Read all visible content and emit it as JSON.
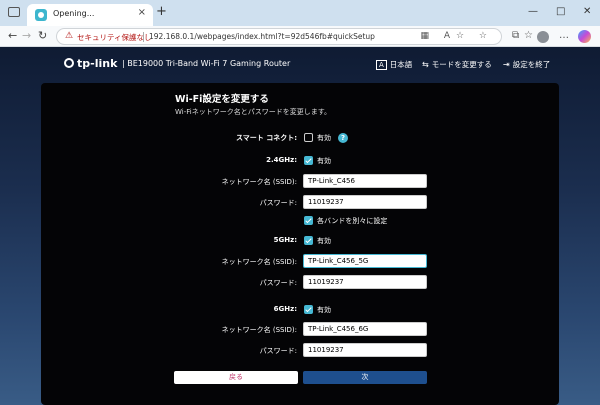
{
  "browser": {
    "tab_title": "Opening...",
    "tab_close": "×",
    "new_tab": "+",
    "window_minimize": "—",
    "window_maximize": "□",
    "window_close": "✕",
    "nav_back": "←",
    "nav_forward": "→",
    "nav_reload": "↻",
    "security_icon": "⚠",
    "security_text": "セキュリティ保護なし",
    "url": "192.168.0.1/webpages/index.html?t=92d546fb#quickSetup",
    "addr_icons": "▦ A☆ ☆",
    "toolbar_icons": {
      "split": "⧉",
      "favorites": "☆",
      "menu": "…"
    }
  },
  "router": {
    "brand": "tp-link",
    "model": "|  BE19000 Tri-Band Wi-Fi 7 Gaming Router",
    "language": "日本語",
    "language_icon": "A",
    "change_mode": "モードを変更する",
    "change_mode_icon": "⇆",
    "exit_setup": "設定を終了",
    "exit_setup_icon": "⇥"
  },
  "panel": {
    "title": "Wi-Fi設定を変更する",
    "subtitle": "Wi-Fiネットワーク名とパスワードを変更します。",
    "smart_connect": {
      "label": "スマート コネクト:",
      "checkbox_label": "有効",
      "checked": false,
      "help": "?"
    },
    "band_24": {
      "label": "2.4GHz:",
      "enable_label": "有効",
      "checked": true,
      "ssid_label": "ネットワーク名 (SSID):",
      "ssid": "TP-Link_C456",
      "password_label": "パスワード:",
      "password": "11019237"
    },
    "separate_bands": {
      "label": "各バンドを別々に設定",
      "checked": true
    },
    "band_5": {
      "label": "5GHz:",
      "enable_label": "有効",
      "checked": true,
      "ssid_label": "ネットワーク名 (SSID):",
      "ssid": "TP-Link_C456_5G",
      "password_label": "パスワード:",
      "password": "11019237"
    },
    "band_6": {
      "label": "6GHz:",
      "enable_label": "有効",
      "checked": true,
      "ssid_label": "ネットワーク名 (SSID):",
      "ssid": "TP-Link_C456_6G",
      "password_label": "パスワード:",
      "password": "11019237"
    },
    "back_button": "戻る",
    "next_button": "次"
  },
  "colors": {
    "accent": "#46b8d3",
    "next_button": "#1e4f8e",
    "back_text": "#c0326a",
    "panel_bg": "#040406"
  }
}
